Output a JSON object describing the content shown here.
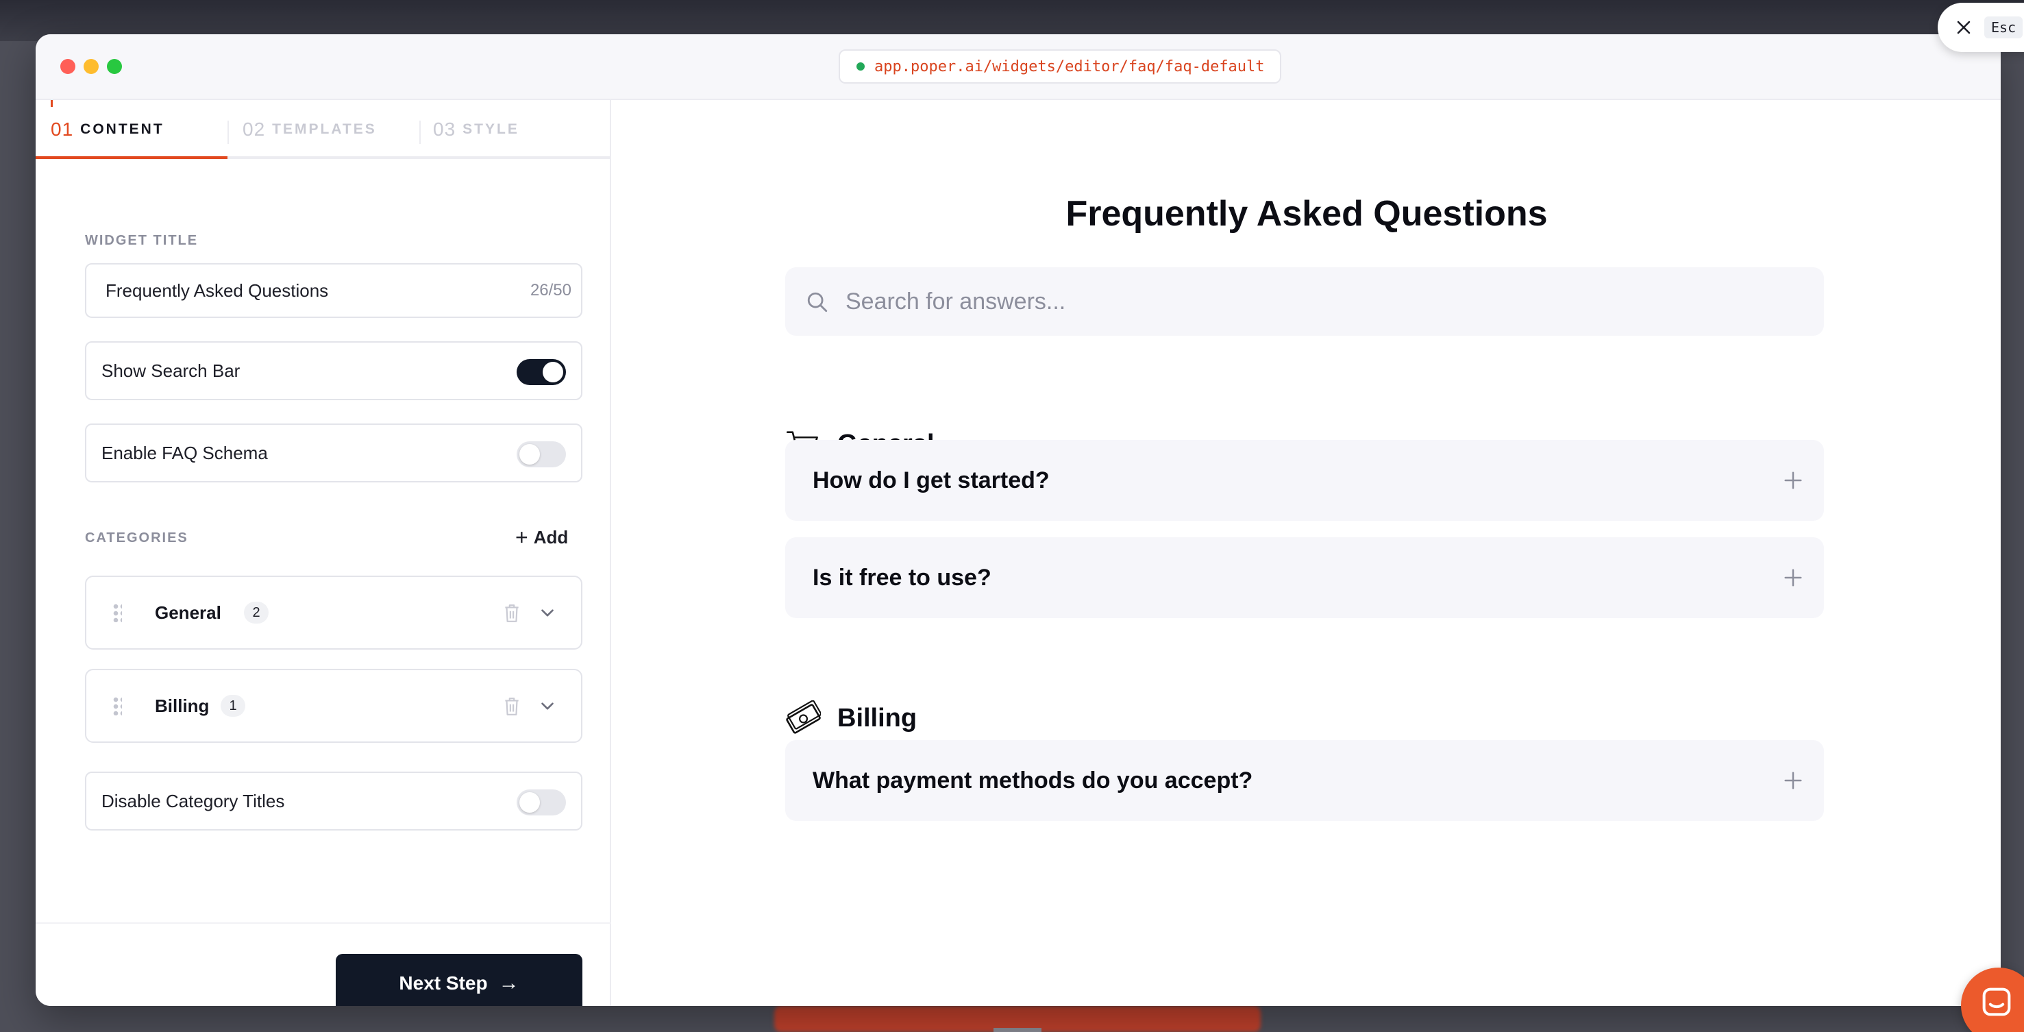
{
  "window": {
    "url": "app.poper.ai/widgets/editor/faq/faq-default"
  },
  "tabs": [
    {
      "num": "01",
      "label": "CONTENT"
    },
    {
      "num": "02",
      "label": "TEMPLATES"
    },
    {
      "num": "03",
      "label": "STYLE"
    }
  ],
  "settings": {
    "widget_title_label": "WIDGET TITLE",
    "widget_title_value": "Frequently Asked Questions",
    "widget_title_counter": "26/50",
    "show_search_bar": {
      "label": "Show Search Bar",
      "on": true
    },
    "enable_faq_schema": {
      "label": "Enable FAQ Schema",
      "on": false
    },
    "categories_label": "CATEGORIES",
    "add_label": "Add",
    "categories": [
      {
        "name": "General",
        "count": "2"
      },
      {
        "name": "Billing",
        "count": "1"
      }
    ],
    "disable_category_titles": {
      "label": "Disable Category Titles",
      "on": false
    },
    "next_step_label": "Next Step"
  },
  "preview": {
    "title": "Frequently Asked Questions",
    "search_placeholder": "Search for answers...",
    "categories": [
      {
        "name": "General",
        "icon": "shopping-cart-icon",
        "questions": [
          "How do I get started?",
          "Is it free to use?"
        ]
      },
      {
        "name": "Billing",
        "icon": "money-icon",
        "questions": [
          "What payment methods do you accept?"
        ]
      }
    ]
  },
  "floating": {
    "esc_label": "Esc"
  },
  "colors": {
    "accent": "#e2491f",
    "primary_dark": "#111827",
    "url_text": "#d9441f",
    "chat_button": "#ec5a2c"
  }
}
